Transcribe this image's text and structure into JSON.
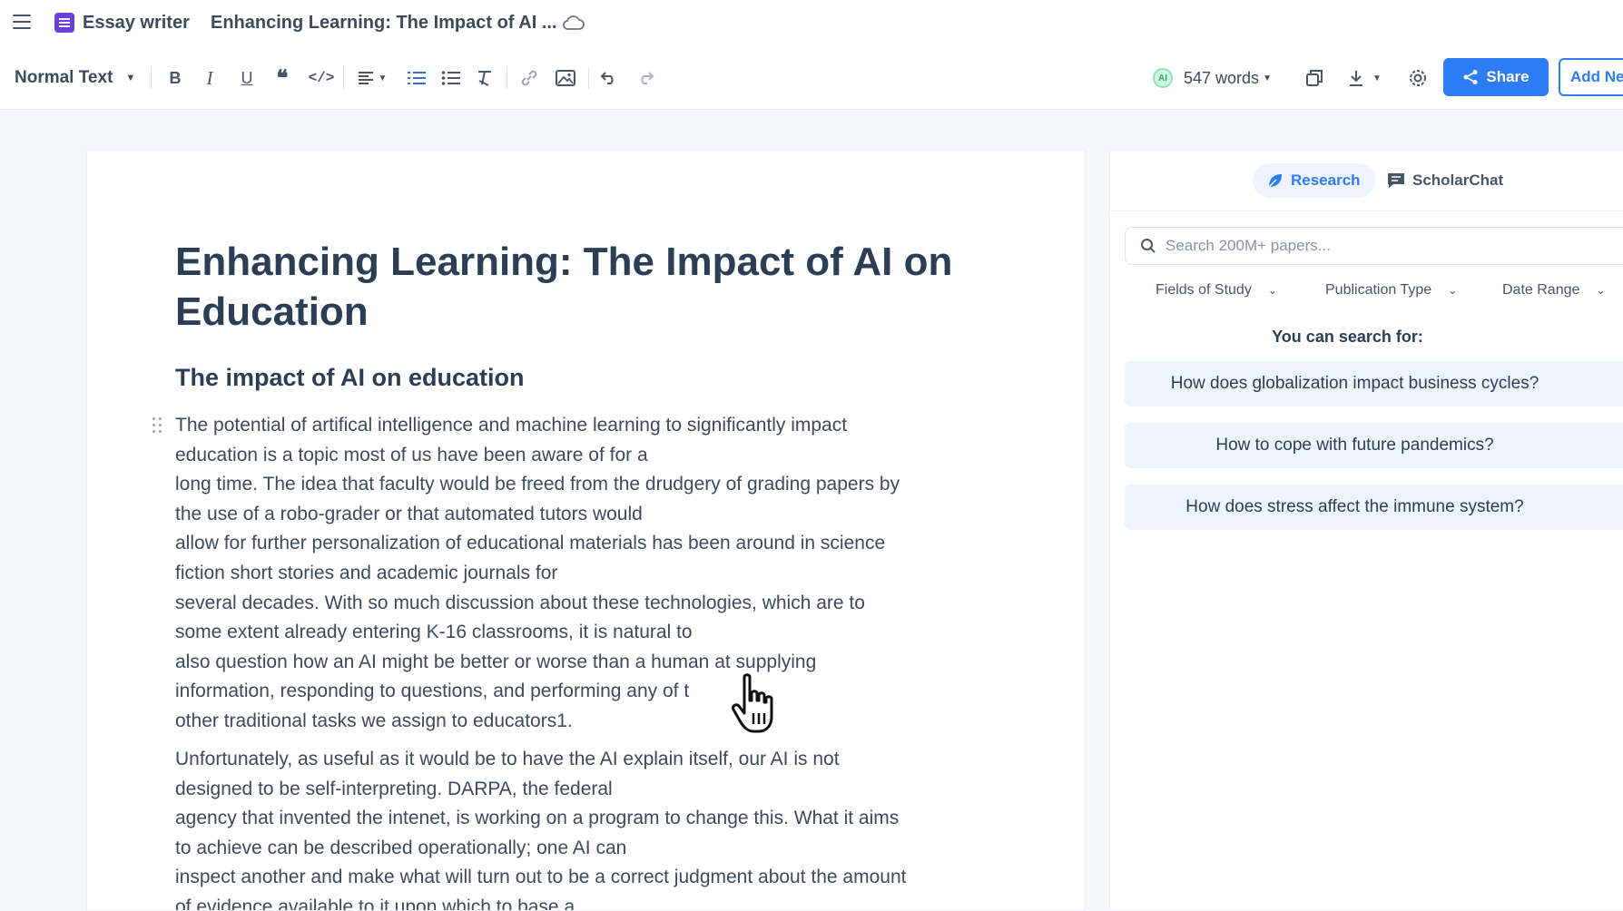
{
  "app": {
    "name": "Essay writer",
    "doc_title": "Enhancing Learning: The Impact of AI ..."
  },
  "toolbar": {
    "text_style": "Normal Text",
    "word_count": "547 words",
    "share_label": "Share",
    "add_new_label": "Add Ne"
  },
  "essay": {
    "title_lines": [
      "Enhancing Learning: The Impact of AI on",
      "Education"
    ],
    "heading": "The impact of AI on education",
    "para1_lines": [
      "The potential of artifical intelligence and machine learning to significantly impact",
      "education is a topic most of us have been aware of for a",
      "long time. The idea that faculty would be freed from the drudgery of grading papers by",
      "the use of a robo-grader or that automated tutors would",
      "allow for further personalization of educational materials has been around in science",
      "fiction short stories and academic journals for",
      "several decades. With so much discussion about these technologies, which are to",
      "some extent already entering K-16 classrooms, it is natural to",
      "also question how an AI might be better or worse than a human at supplying",
      "information, responding to questions, and performing any of t",
      "other traditional tasks we assign to educators1."
    ],
    "para2_lines": [
      "Unfortunately, as useful as it would be to have the AI explain itself, our AI is not",
      "designed to be self-interpreting. DARPA, the federal",
      "agency that invented the intenet, is working on a program to change this. What it aims",
      "to achieve can be described operationally; one AI can",
      "inspect another and make what will turn out to be a correct judgment about the amount",
      "of evidence available to it upon which to base a"
    ]
  },
  "panel": {
    "tabs": [
      {
        "label": "Research",
        "active": true
      },
      {
        "label": "ScholarChat",
        "active": false
      }
    ],
    "search_placeholder": "Search 200M+ papers...",
    "filters": [
      "Fields of Study",
      "Publication Type",
      "Date Range"
    ],
    "search_for_label": "You can search for:",
    "suggestions": [
      "How does globalization impact business cycles?",
      "How to cope with future pandemics?",
      "How does stress affect the immune system?"
    ]
  },
  "colors": {
    "accent": "#2d7df6",
    "brand": "#6d3fd9",
    "text": "#2c3e55"
  }
}
